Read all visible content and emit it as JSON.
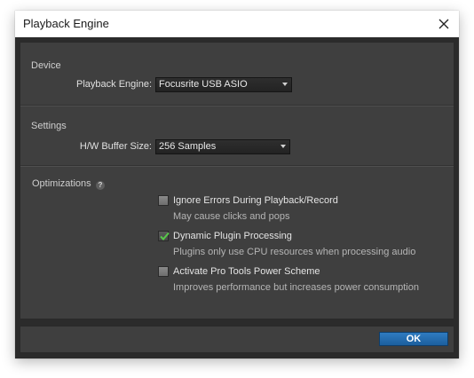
{
  "window": {
    "title": "Playback Engine"
  },
  "device": {
    "section_label": "Device",
    "engine_label": "Playback Engine:",
    "engine_value": "Focusrite USB ASIO"
  },
  "settings": {
    "section_label": "Settings",
    "buffer_label": "H/W Buffer Size:",
    "buffer_value": "256 Samples"
  },
  "optimizations": {
    "section_label": "Optimizations",
    "help_glyph": "?",
    "options": [
      {
        "label": "Ignore Errors During Playback/Record",
        "description": "May cause clicks and pops",
        "checked": false
      },
      {
        "label": "Dynamic Plugin Processing",
        "description": "Plugins only use CPU resources when processing audio",
        "checked": true
      },
      {
        "label": "Activate Pro Tools Power Scheme",
        "description": "Improves performance but increases power consumption",
        "checked": false
      }
    ]
  },
  "footer": {
    "ok_label": "OK"
  },
  "colors": {
    "ok_button": "#2a6fb0",
    "check_mark": "#58c94a",
    "panel": "#3f3f3f",
    "frame": "#2b2b2b"
  }
}
